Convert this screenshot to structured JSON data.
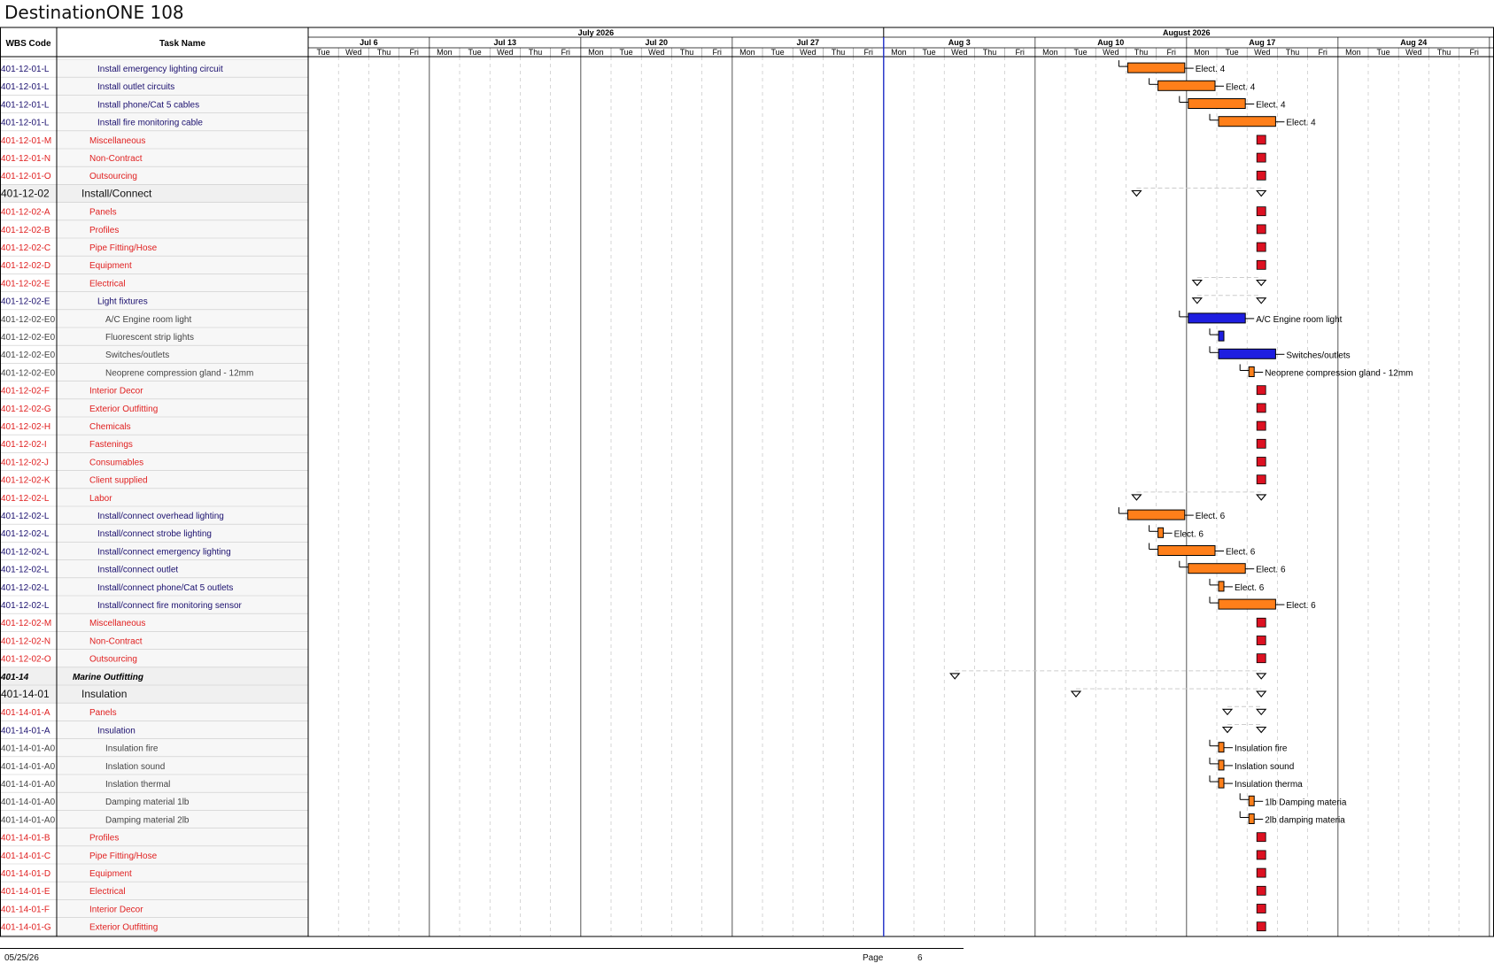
{
  "page": {
    "title": "DestinationONE 108",
    "footer_date": "05/25/26",
    "footer_page_label": "Page",
    "footer_page_number": "6"
  },
  "headers": {
    "wbs": "WBS Code",
    "task": "Task Name"
  },
  "months": [
    {
      "label": "July 2026"
    },
    {
      "label": "August 2026"
    }
  ],
  "weeks": [
    {
      "label": "Jul 6"
    },
    {
      "label": "Jul 13"
    },
    {
      "label": "Jul 20"
    },
    {
      "label": "Jul 27"
    },
    {
      "label": "Aug 3"
    },
    {
      "label": "Aug 10"
    },
    {
      "label": "Aug 17"
    },
    {
      "label": "Aug 24"
    }
  ],
  "day_names": [
    "Mon",
    "Tue",
    "Wed",
    "Thu",
    "Fri"
  ],
  "colors": {
    "labor": "#1a0f6e",
    "category": "#e02020",
    "item": "#444444",
    "section": "#111111",
    "bar_orange": "#ff7f1a",
    "bar_blue": "#1e1ee0",
    "milestone_red": "#dd1122",
    "today_line": "#2233cc"
  },
  "rows": [
    {
      "wbs": "401-12-01-L",
      "name": "Install emergency lighting circuit",
      "kind": "labor"
    },
    {
      "wbs": "401-12-01-L",
      "name": "Install outlet circuits",
      "kind": "labor"
    },
    {
      "wbs": "401-12-01-L",
      "name": "Install phone/Cat 5 cables",
      "kind": "labor"
    },
    {
      "wbs": "401-12-01-L",
      "name": "Install fire monitoring cable",
      "kind": "labor"
    },
    {
      "wbs": "401-12-01-M",
      "name": "Miscellaneous",
      "kind": "category"
    },
    {
      "wbs": "401-12-01-N",
      "name": "Non-Contract",
      "kind": "category"
    },
    {
      "wbs": "401-12-01-O",
      "name": "Outsourcing",
      "kind": "category"
    },
    {
      "wbs": "401-12-02",
      "name": "Install/Connect",
      "kind": "section"
    },
    {
      "wbs": "401-12-02-A",
      "name": "Panels",
      "kind": "category"
    },
    {
      "wbs": "401-12-02-B",
      "name": "Profiles",
      "kind": "category"
    },
    {
      "wbs": "401-12-02-C",
      "name": "Pipe Fitting/Hose",
      "kind": "category"
    },
    {
      "wbs": "401-12-02-D",
      "name": "Equipment",
      "kind": "category"
    },
    {
      "wbs": "401-12-02-E",
      "name": "Electrical",
      "kind": "category"
    },
    {
      "wbs": "401-12-02-E",
      "name": "Light fixtures",
      "kind": "labor"
    },
    {
      "wbs": "401-12-02-E0",
      "name": "A/C Engine room light",
      "kind": "item"
    },
    {
      "wbs": "401-12-02-E0",
      "name": "Fluorescent strip lights",
      "kind": "item"
    },
    {
      "wbs": "401-12-02-E0",
      "name": "Switches/outlets",
      "kind": "item"
    },
    {
      "wbs": "401-12-02-E0",
      "name": "Neoprene compression gland - 12mm",
      "kind": "item"
    },
    {
      "wbs": "401-12-02-F",
      "name": "Interior Decor",
      "kind": "category"
    },
    {
      "wbs": "401-12-02-G",
      "name": "Exterior Outfitting",
      "kind": "category"
    },
    {
      "wbs": "401-12-02-H",
      "name": "Chemicals",
      "kind": "category"
    },
    {
      "wbs": "401-12-02-I",
      "name": "Fastenings",
      "kind": "category"
    },
    {
      "wbs": "401-12-02-J",
      "name": "Consumables",
      "kind": "category"
    },
    {
      "wbs": "401-12-02-K",
      "name": "Client supplied",
      "kind": "category"
    },
    {
      "wbs": "401-12-02-L",
      "name": "Labor",
      "kind": "category"
    },
    {
      "wbs": "401-12-02-L",
      "name": "Install/connect overhead lighting",
      "kind": "labor"
    },
    {
      "wbs": "401-12-02-L",
      "name": "Install/connect strobe lighting",
      "kind": "labor"
    },
    {
      "wbs": "401-12-02-L",
      "name": "Install/connect emergency lighting",
      "kind": "labor"
    },
    {
      "wbs": "401-12-02-L",
      "name": "Install/connect outlet",
      "kind": "labor"
    },
    {
      "wbs": "401-12-02-L",
      "name": "Install/connect phone/Cat 5 outlets",
      "kind": "labor"
    },
    {
      "wbs": "401-12-02-L",
      "name": "Install/connect fire monitoring sensor",
      "kind": "labor"
    },
    {
      "wbs": "401-12-02-M",
      "name": "Miscellaneous",
      "kind": "category"
    },
    {
      "wbs": "401-12-02-N",
      "name": "Non-Contract",
      "kind": "category"
    },
    {
      "wbs": "401-12-02-O",
      "name": "Outsourcing",
      "kind": "category"
    },
    {
      "wbs": "401-14",
      "name": "Marine Outfitting",
      "kind": "summary"
    },
    {
      "wbs": "401-14-01",
      "name": "Insulation",
      "kind": "section"
    },
    {
      "wbs": "401-14-01-A",
      "name": "Panels",
      "kind": "category"
    },
    {
      "wbs": "401-14-01-A",
      "name": "Insulation",
      "kind": "labor"
    },
    {
      "wbs": "401-14-01-A0",
      "name": "Insulation fire",
      "kind": "item"
    },
    {
      "wbs": "401-14-01-A0",
      "name": "Inslation sound",
      "kind": "item"
    },
    {
      "wbs": "401-14-01-A0",
      "name": "Inslation thermal",
      "kind": "item"
    },
    {
      "wbs": "401-14-01-A0",
      "name": "Damping material 1lb",
      "kind": "item"
    },
    {
      "wbs": "401-14-01-A0",
      "name": "Damping material 2lb",
      "kind": "item"
    },
    {
      "wbs": "401-14-01-B",
      "name": "Profiles",
      "kind": "category"
    },
    {
      "wbs": "401-14-01-C",
      "name": "Pipe Fitting/Hose",
      "kind": "category"
    },
    {
      "wbs": "401-14-01-D",
      "name": "Equipment",
      "kind": "category"
    },
    {
      "wbs": "401-14-01-E",
      "name": "Electrical",
      "kind": "category"
    },
    {
      "wbs": "401-14-01-F",
      "name": "Interior Decor",
      "kind": "category"
    },
    {
      "wbs": "401-14-01-G",
      "name": "Exterior Outfitting",
      "kind": "category"
    }
  ],
  "gantt": [
    {
      "row": 0,
      "type": "bar",
      "color": "orange",
      "start": "2026-08-13",
      "end": "2026-08-14",
      "label": "Elect. 4"
    },
    {
      "row": 1,
      "type": "bar",
      "color": "orange",
      "start": "2026-08-14",
      "end": "2026-08-15",
      "label": "Elect. 4"
    },
    {
      "row": 2,
      "type": "bar",
      "color": "orange",
      "start": "2026-08-17",
      "end": "2026-08-18",
      "label": "Elect. 4"
    },
    {
      "row": 3,
      "type": "bar",
      "color": "orange",
      "start": "2026-08-18",
      "end": "2026-08-19",
      "label": "Elect. 4"
    },
    {
      "row": 4,
      "type": "milestone",
      "date": "2026-08-19"
    },
    {
      "row": 5,
      "type": "milestone",
      "date": "2026-08-19"
    },
    {
      "row": 6,
      "type": "milestone",
      "date": "2026-08-19"
    },
    {
      "row": 7,
      "type": "summary",
      "start": "2026-08-13",
      "end": "2026-08-19"
    },
    {
      "row": 8,
      "type": "milestone",
      "date": "2026-08-19"
    },
    {
      "row": 9,
      "type": "milestone",
      "date": "2026-08-19"
    },
    {
      "row": 10,
      "type": "milestone",
      "date": "2026-08-19"
    },
    {
      "row": 11,
      "type": "milestone",
      "date": "2026-08-19"
    },
    {
      "row": 12,
      "type": "summary",
      "start": "2026-08-17",
      "end": "2026-08-19"
    },
    {
      "row": 13,
      "type": "summary",
      "start": "2026-08-17",
      "end": "2026-08-19"
    },
    {
      "row": 14,
      "type": "bar",
      "color": "blue",
      "start": "2026-08-17",
      "end": "2026-08-18",
      "label": "A/C Engine room light"
    },
    {
      "row": 15,
      "type": "bar",
      "color": "blue",
      "start": "2026-08-18",
      "end": "2026-08-18",
      "label": ""
    },
    {
      "row": 16,
      "type": "bar",
      "color": "blue",
      "start": "2026-08-18",
      "end": "2026-08-19",
      "label": "Switches/outlets"
    },
    {
      "row": 17,
      "type": "bar",
      "color": "orange",
      "start": "2026-08-19",
      "end": "2026-08-19",
      "label": "Neoprene compression gland - 12mm"
    },
    {
      "row": 18,
      "type": "milestone",
      "date": "2026-08-19"
    },
    {
      "row": 19,
      "type": "milestone",
      "date": "2026-08-19"
    },
    {
      "row": 20,
      "type": "milestone",
      "date": "2026-08-19"
    },
    {
      "row": 21,
      "type": "milestone",
      "date": "2026-08-19"
    },
    {
      "row": 22,
      "type": "milestone",
      "date": "2026-08-19"
    },
    {
      "row": 23,
      "type": "milestone",
      "date": "2026-08-19"
    },
    {
      "row": 24,
      "type": "summary",
      "start": "2026-08-13",
      "end": "2026-08-19"
    },
    {
      "row": 25,
      "type": "bar",
      "color": "orange",
      "start": "2026-08-13",
      "end": "2026-08-14",
      "label": "Elect. 6"
    },
    {
      "row": 26,
      "type": "bar",
      "color": "orange",
      "start": "2026-08-14",
      "end": "2026-08-14",
      "label": "Elect. 6"
    },
    {
      "row": 27,
      "type": "bar",
      "color": "orange",
      "start": "2026-08-14",
      "end": "2026-08-15",
      "label": "Elect. 6"
    },
    {
      "row": 28,
      "type": "bar",
      "color": "orange",
      "start": "2026-08-17",
      "end": "2026-08-18",
      "label": "Elect. 6"
    },
    {
      "row": 29,
      "type": "bar",
      "color": "orange",
      "start": "2026-08-18",
      "end": "2026-08-18",
      "label": "Elect. 6"
    },
    {
      "row": 30,
      "type": "bar",
      "color": "orange",
      "start": "2026-08-18",
      "end": "2026-08-19",
      "label": "Elect. 6"
    },
    {
      "row": 31,
      "type": "milestone",
      "date": "2026-08-19"
    },
    {
      "row": 32,
      "type": "milestone",
      "date": "2026-08-19"
    },
    {
      "row": 33,
      "type": "milestone",
      "date": "2026-08-19"
    },
    {
      "row": 34,
      "type": "summary",
      "start": "2026-08-05",
      "end": "2026-08-19"
    },
    {
      "row": 35,
      "type": "summary",
      "start": "2026-08-11",
      "end": "2026-08-19"
    },
    {
      "row": 36,
      "type": "summary",
      "start": "2026-08-18",
      "end": "2026-08-19"
    },
    {
      "row": 37,
      "type": "summary",
      "start": "2026-08-18",
      "end": "2026-08-19"
    },
    {
      "row": 38,
      "type": "bar",
      "color": "orange",
      "start": "2026-08-18",
      "end": "2026-08-18",
      "label": "Insulation fire"
    },
    {
      "row": 39,
      "type": "bar",
      "color": "orange",
      "start": "2026-08-18",
      "end": "2026-08-18",
      "label": "Inslation sound"
    },
    {
      "row": 40,
      "type": "bar",
      "color": "orange",
      "start": "2026-08-18",
      "end": "2026-08-18",
      "label": "Insulation therma"
    },
    {
      "row": 41,
      "type": "bar",
      "color": "orange",
      "start": "2026-08-19",
      "end": "2026-08-19",
      "label": "1lb Damping materia"
    },
    {
      "row": 42,
      "type": "bar",
      "color": "orange",
      "start": "2026-08-19",
      "end": "2026-08-19",
      "label": "2lb damping materia"
    },
    {
      "row": 43,
      "type": "milestone",
      "date": "2026-08-19"
    },
    {
      "row": 44,
      "type": "milestone",
      "date": "2026-08-19"
    },
    {
      "row": 45,
      "type": "milestone",
      "date": "2026-08-19"
    },
    {
      "row": 46,
      "type": "milestone",
      "date": "2026-08-19"
    },
    {
      "row": 47,
      "type": "milestone",
      "date": "2026-08-19"
    },
    {
      "row": 48,
      "type": "milestone",
      "date": "2026-08-19"
    }
  ],
  "status_date": "2026-08-03"
}
